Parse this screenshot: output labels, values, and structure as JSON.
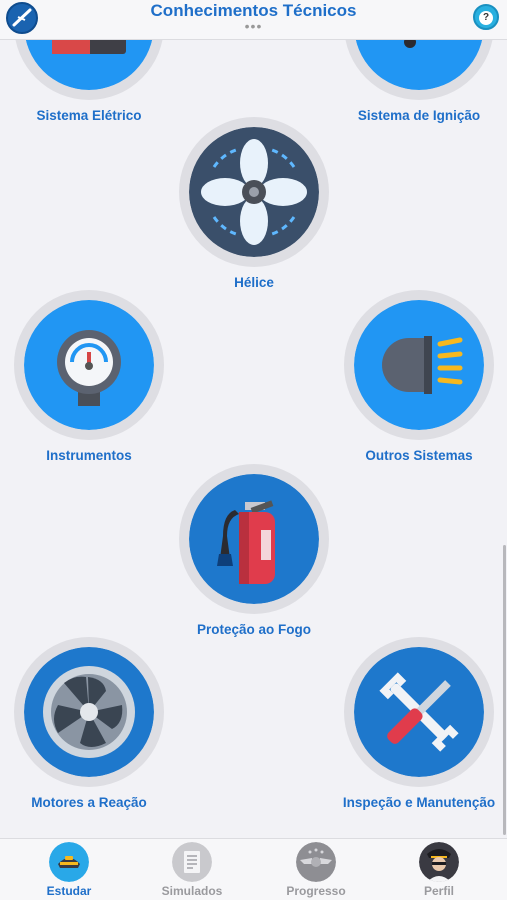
{
  "header": {
    "title": "Conhecimentos Técnicos",
    "dots": "•••",
    "help_glyph": "?",
    "logo_icon": "airplane-logo-icon",
    "help_icon": "help-chat-icon"
  },
  "topics": [
    {
      "label": "Sistema Elétrico",
      "icon": "electric-battery-icon"
    },
    {
      "label": "Sistema de Ignição",
      "icon": "spark-plug-icon"
    },
    {
      "label": "Hélice",
      "icon": "propeller-icon"
    },
    {
      "label": "Instrumentos",
      "icon": "pressure-gauge-icon"
    },
    {
      "label": "Outros Sistemas",
      "icon": "headlight-icon"
    },
    {
      "label": "Proteção ao Fogo",
      "icon": "fire-extinguisher-icon"
    },
    {
      "label": "Motores a Reação",
      "icon": "jet-engine-icon"
    },
    {
      "label": "Inspeção e Manutenção",
      "icon": "wrench-screwdriver-icon"
    }
  ],
  "tabs": [
    {
      "label": "Estudar",
      "active": true,
      "icon": "pilot-hat-icon"
    },
    {
      "label": "Simulados",
      "active": false,
      "icon": "document-icon"
    },
    {
      "label": "Progresso",
      "active": false,
      "icon": "wings-badge-icon"
    },
    {
      "label": "Perfil",
      "active": false,
      "icon": "pilot-avatar-icon"
    }
  ],
  "colors": {
    "accent": "#1f6fc9",
    "inactive_tab": "#9a9a9e",
    "disc_bright": "#2196f3",
    "disc_dark": "#1e78cc",
    "disc_navy": "#3a4f6a"
  }
}
